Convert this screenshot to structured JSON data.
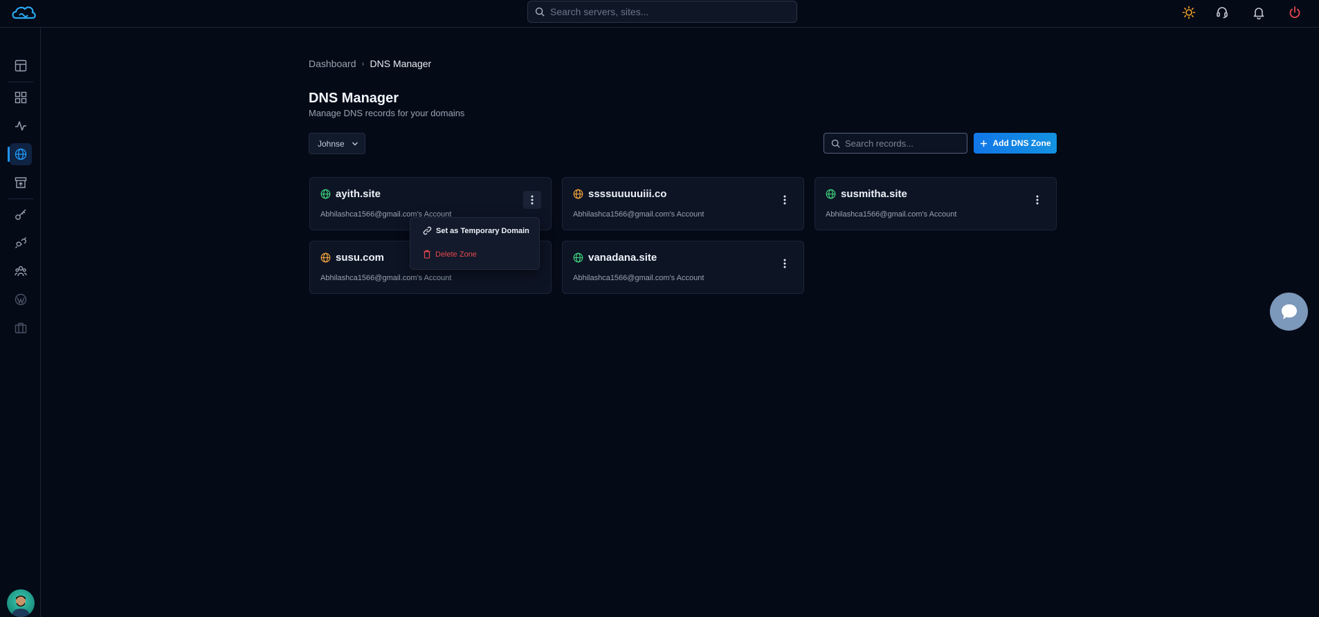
{
  "topbar": {
    "search_placeholder": "Search servers, sites..."
  },
  "breadcrumb": {
    "items": [
      "Dashboard"
    ],
    "current": "DNS Manager"
  },
  "page": {
    "title": "DNS Manager",
    "subtitle": "Manage DNS records for your domains"
  },
  "toolbar": {
    "account_selected": "Johnse",
    "records_search_placeholder": "Search records...",
    "add_zone_label": "Add DNS Zone"
  },
  "zones": [
    {
      "name": "ayith.site",
      "account": "Abhilashca1566@gmail.com's Account",
      "status_color": "#3fcf7d"
    },
    {
      "name": "ssssuuuuuiii.co",
      "account": "Abhilashca1566@gmail.com's Account",
      "status_color": "#f0a23b"
    },
    {
      "name": "susmitha.site",
      "account": "Abhilashca1566@gmail.com's Account",
      "status_color": "#3fcf7d"
    },
    {
      "name": "susu.com",
      "account": "Abhilashca1566@gmail.com's Account",
      "status_color": "#f0a23b"
    },
    {
      "name": "vanadana.site",
      "account": "Abhilashca1566@gmail.com's Account",
      "status_color": "#3fcf7d"
    }
  ],
  "context_menu": {
    "set_temp_label": "Set as Temporary Domain",
    "delete_label": "Delete Zone"
  },
  "colors": {
    "accent": "#2196f3",
    "danger": "#e5484d",
    "sun": "#f5a524",
    "power": "#e5484d"
  }
}
